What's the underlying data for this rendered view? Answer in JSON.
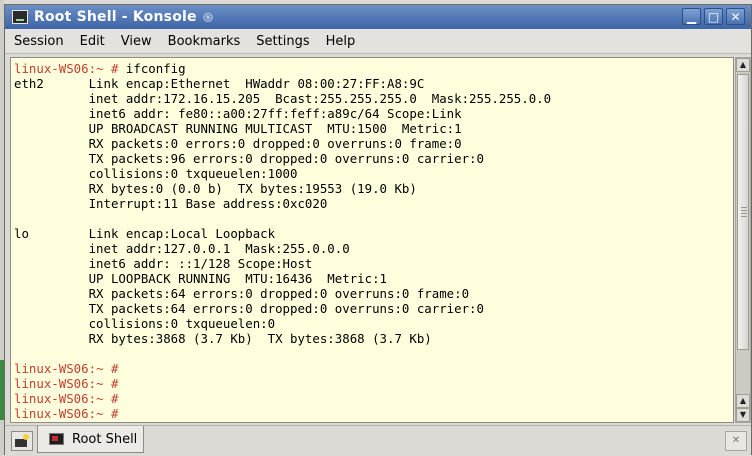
{
  "window": {
    "title": "Root Shell - Konsole",
    "icons": {
      "app": "terminal-icon",
      "title_extra": "spiral-icon"
    },
    "controls": {
      "minimize": "▁",
      "maximize": "□",
      "close": "✕"
    }
  },
  "menubar": {
    "items": [
      "Session",
      "Edit",
      "View",
      "Bookmarks",
      "Settings",
      "Help"
    ]
  },
  "terminal": {
    "colors": {
      "background": "#ffffdd",
      "prompt": "#c0402f",
      "text": "#000000"
    },
    "lines": [
      {
        "prompt": "linux-WS06:~ # ",
        "text": "ifconfig"
      },
      {
        "prompt": "",
        "text": "eth2      Link encap:Ethernet  HWaddr 08:00:27:FF:A8:9C"
      },
      {
        "prompt": "",
        "text": "          inet addr:172.16.15.205  Bcast:255.255.255.0  Mask:255.255.0.0"
      },
      {
        "prompt": "",
        "text": "          inet6 addr: fe80::a00:27ff:feff:a89c/64 Scope:Link"
      },
      {
        "prompt": "",
        "text": "          UP BROADCAST RUNNING MULTICAST  MTU:1500  Metric:1"
      },
      {
        "prompt": "",
        "text": "          RX packets:0 errors:0 dropped:0 overruns:0 frame:0"
      },
      {
        "prompt": "",
        "text": "          TX packets:96 errors:0 dropped:0 overruns:0 carrier:0"
      },
      {
        "prompt": "",
        "text": "          collisions:0 txqueuelen:1000"
      },
      {
        "prompt": "",
        "text": "          RX bytes:0 (0.0 b)  TX bytes:19553 (19.0 Kb)"
      },
      {
        "prompt": "",
        "text": "          Interrupt:11 Base address:0xc020"
      },
      {
        "prompt": "",
        "text": ""
      },
      {
        "prompt": "",
        "text": "lo        Link encap:Local Loopback"
      },
      {
        "prompt": "",
        "text": "          inet addr:127.0.0.1  Mask:255.0.0.0"
      },
      {
        "prompt": "",
        "text": "          inet6 addr: ::1/128 Scope:Host"
      },
      {
        "prompt": "",
        "text": "          UP LOOPBACK RUNNING  MTU:16436  Metric:1"
      },
      {
        "prompt": "",
        "text": "          RX packets:64 errors:0 dropped:0 overruns:0 frame:0"
      },
      {
        "prompt": "",
        "text": "          TX packets:64 errors:0 dropped:0 overruns:0 carrier:0"
      },
      {
        "prompt": "",
        "text": "          collisions:0 txqueuelen:0"
      },
      {
        "prompt": "",
        "text": "          RX bytes:3868 (3.7 Kb)  TX bytes:3868 (3.7 Kb)"
      },
      {
        "prompt": "",
        "text": ""
      },
      {
        "prompt": "linux-WS06:~ # ",
        "text": ""
      },
      {
        "prompt": "linux-WS06:~ # ",
        "text": ""
      },
      {
        "prompt": "linux-WS06:~ # ",
        "text": ""
      },
      {
        "prompt": "linux-WS06:~ # ",
        "text": ""
      }
    ]
  },
  "scrollbar": {
    "arrows": {
      "up": "▲",
      "down": "▼"
    }
  },
  "tabbar": {
    "tabs": [
      {
        "label": "Root Shell",
        "icon": "shell-icon"
      }
    ],
    "icons": {
      "new_tab": "new-session-icon",
      "close_tab": "close-session-icon"
    }
  }
}
